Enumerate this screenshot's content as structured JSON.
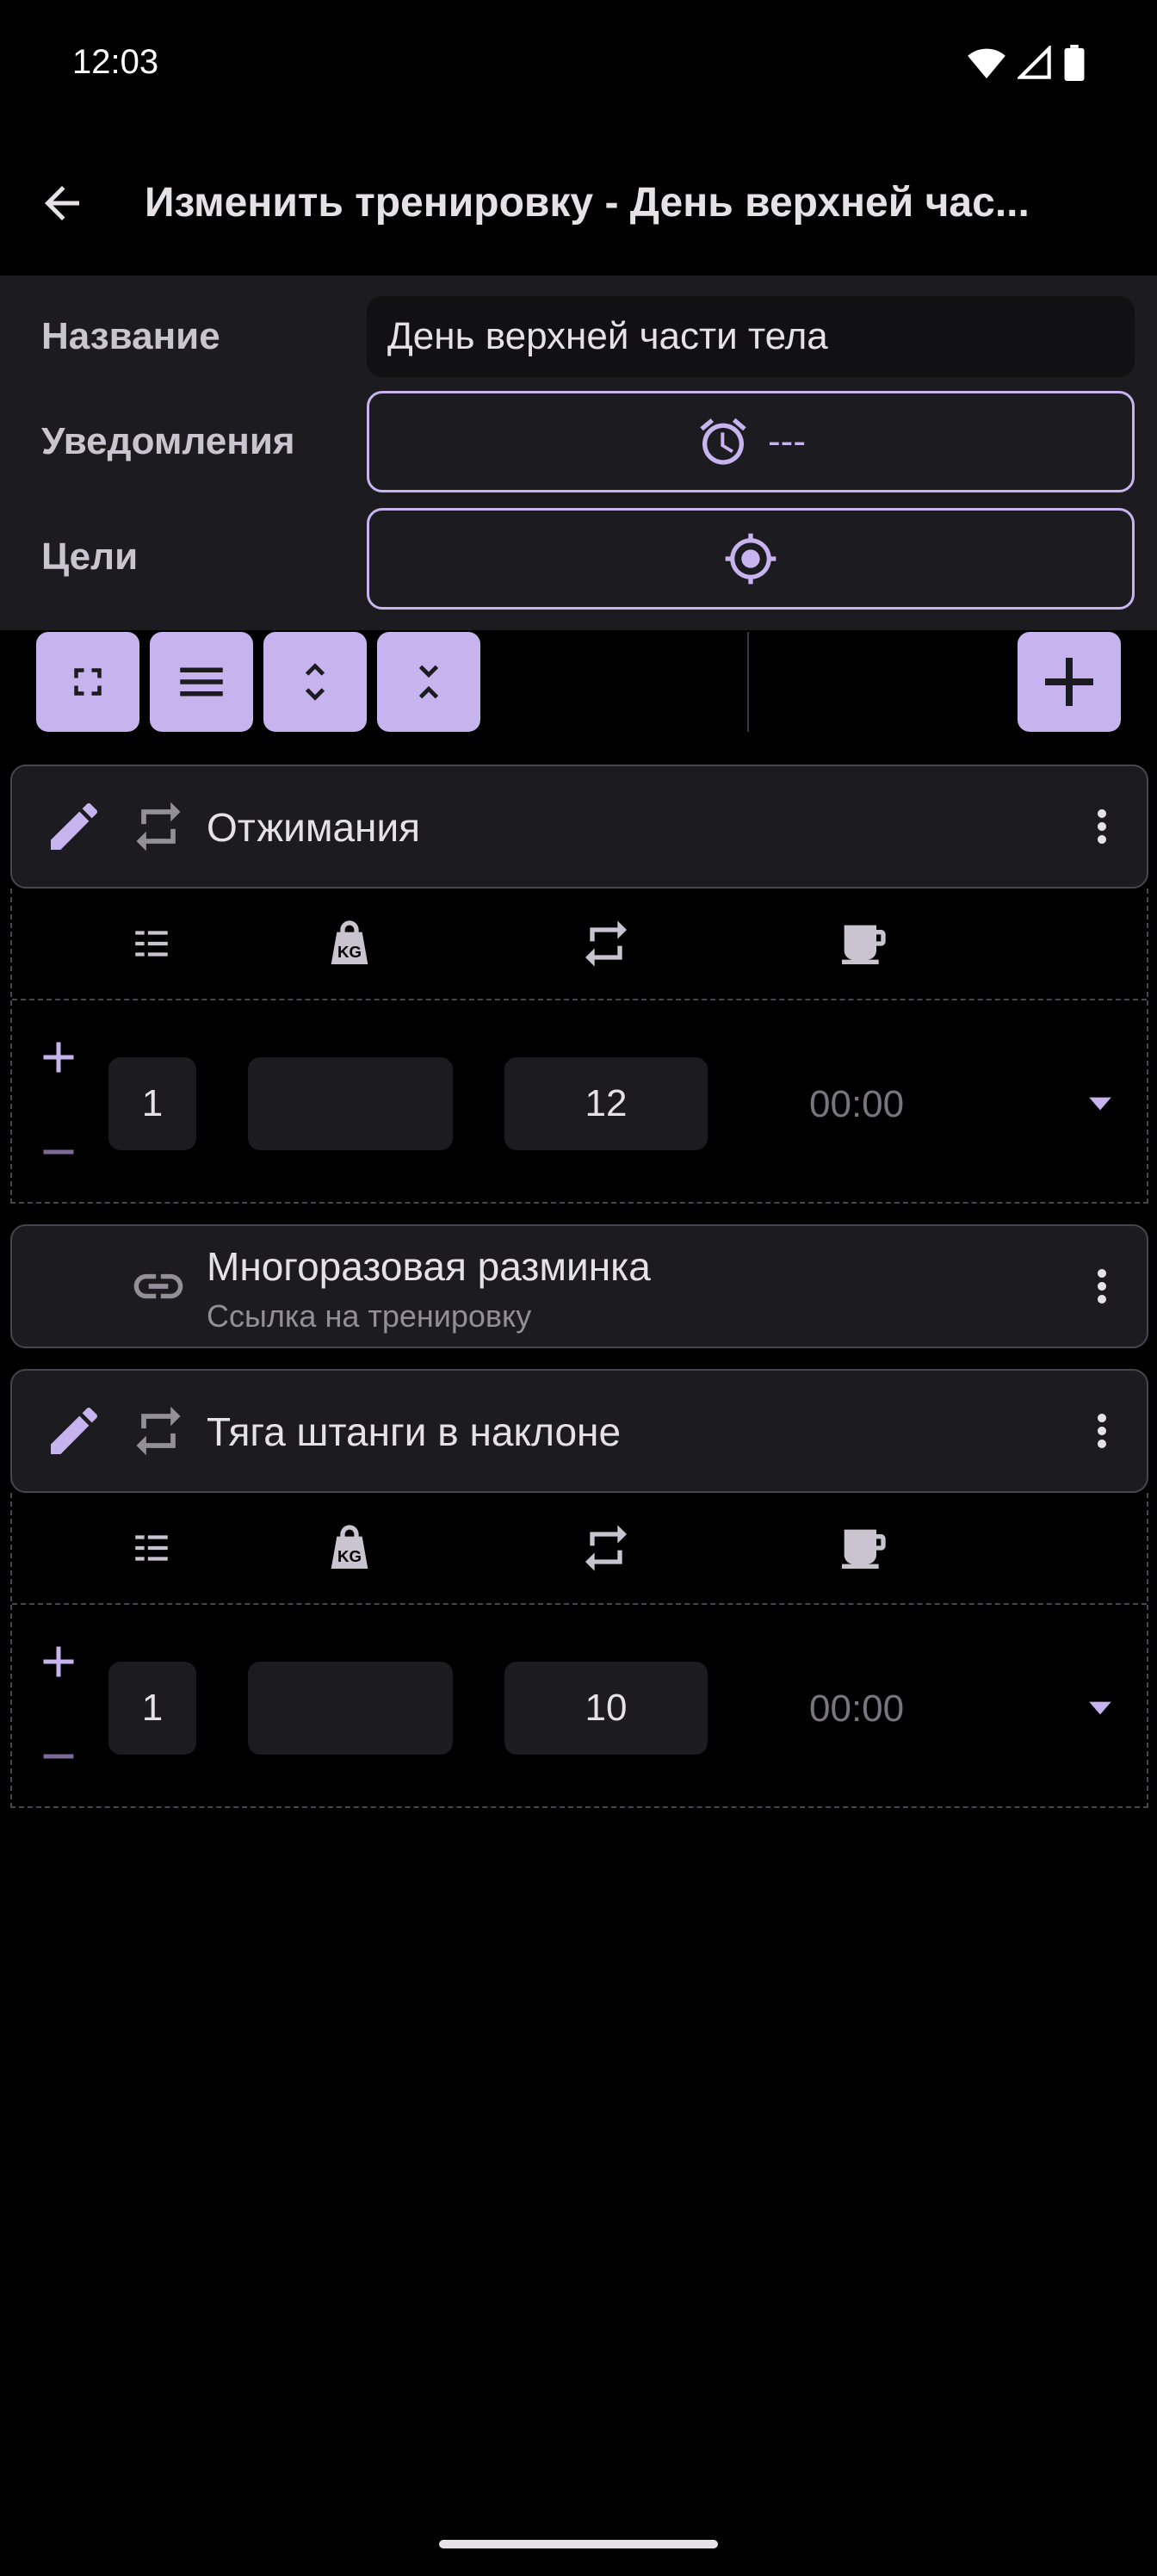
{
  "status_bar": {
    "time": "12:03"
  },
  "app_bar": {
    "title": "Изменить тренировку - День верхней час..."
  },
  "info": {
    "name_label": "Название",
    "name_value": "День верхней части тела",
    "notifications_label": "Уведомления",
    "notifications_value": "---",
    "goals_label": "Цели"
  },
  "exercises": [
    {
      "name": "Отжимания",
      "set": {
        "index": "1",
        "weight": "",
        "reps": "12",
        "rest": "00:00"
      }
    },
    {
      "name": "Многоразовая разминка",
      "subtitle": "Ссылка на тренировку"
    },
    {
      "name": "Тяга штанги в наклоне",
      "set": {
        "index": "1",
        "weight": "",
        "reps": "10",
        "rest": "00:00"
      }
    }
  ],
  "colors": {
    "accent": "#c7b3ee",
    "background": "#000000",
    "surface": "#1c1b1f"
  },
  "icons": [
    "back-arrow-icon",
    "alarm-icon",
    "crosshair-icon",
    "expand-icon",
    "menu-icon",
    "expand-all-icon",
    "collapse-all-icon",
    "add-icon",
    "edit-icon",
    "repeat-icon",
    "more-vert-icon",
    "link-icon",
    "list-icon",
    "kettlebell-icon",
    "coffee-icon",
    "dropdown-icon"
  ]
}
